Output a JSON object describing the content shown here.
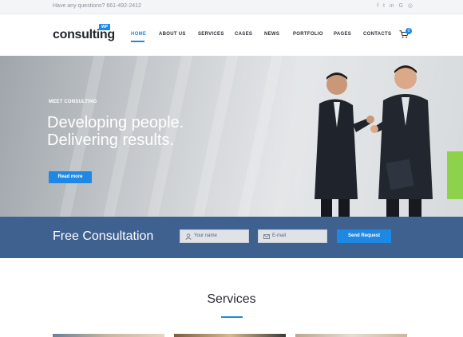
{
  "topbar": {
    "question": "Have any questions? 661-492-2412",
    "social_icons": [
      "facebook-icon",
      "twitter-icon",
      "linkedin-icon",
      "google-icon",
      "dribbble-icon"
    ],
    "social_glyphs": [
      "f",
      "t",
      "in",
      "G",
      "◎"
    ]
  },
  "header": {
    "logo": "consulting",
    "logo_badge": "WP",
    "nav": [
      "HOME",
      "ABOUT US",
      "SERVICES",
      "CASES",
      "NEWS",
      "PORTFOLIO",
      "PAGES",
      "CONTACTS"
    ],
    "active_nav": "HOME",
    "cart_count": "0"
  },
  "hero": {
    "kicker": "MEET CONSULTING",
    "title_line1": "Developing people.",
    "title_line2": "Delivering results.",
    "button": "Read more"
  },
  "consultation": {
    "title": "Free Consultation",
    "name_placeholder": "Your name",
    "email_placeholder": "E-mail",
    "button": "Send Request"
  },
  "services": {
    "title": "Services"
  },
  "colors": {
    "accent": "#1e88e5",
    "consult_band": "#3e6190",
    "topbar": "#f4f5f7"
  }
}
